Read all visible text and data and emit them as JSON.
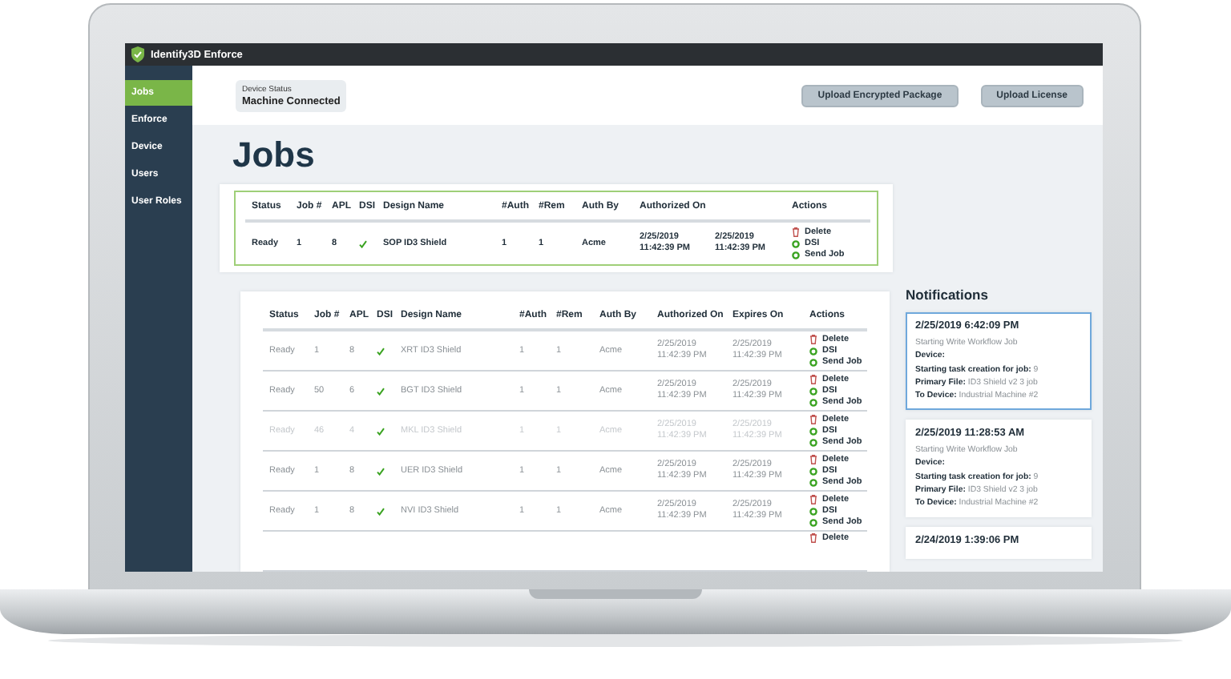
{
  "app": {
    "title": "Identify3D Enforce"
  },
  "sidebar": {
    "items": [
      {
        "label": "Jobs",
        "selected": true
      },
      {
        "label": "Enforce",
        "selected": false
      },
      {
        "label": "Device",
        "selected": false
      },
      {
        "label": "Users",
        "selected": false
      },
      {
        "label": "User Roles",
        "selected": false
      }
    ]
  },
  "header": {
    "device_status": {
      "label": "Device Status",
      "value": "Machine Connected"
    },
    "buttons": [
      "Upload Encrypted Package",
      "Upload License"
    ]
  },
  "page_title": "Jobs",
  "active_jobs": {
    "columns": [
      {
        "label": "Status"
      },
      {
        "label": "Job #"
      },
      {
        "label": "APL"
      },
      {
        "label": "DSI"
      },
      {
        "label": "Design Name"
      },
      {
        "label": "#Auth"
      },
      {
        "label": "#Rem"
      },
      {
        "label": "Auth By"
      },
      {
        "label": "Authorized On"
      },
      {},
      {
        "label": "Actions"
      }
    ],
    "rows": [
      {
        "faded": false,
        "cells": [
          "Ready",
          "1",
          "8"
        ],
        "dsi": true,
        "design": "SOP ID3 Shield",
        "cells2": [
          "1",
          "1",
          "Acme",
          "2/25/2019\n11:42:39 PM",
          "2/25/2019\n11:42:39 PM"
        ],
        "actions": [
          {
            "kind": "delete",
            "label": "Delete"
          },
          {
            "kind": "go",
            "label": "DSI"
          },
          {
            "kind": "go",
            "label": "Send Job"
          }
        ]
      }
    ]
  },
  "jobs": {
    "columns": [
      {
        "label": "Status"
      },
      {
        "label": "Job #"
      },
      {
        "label": "APL"
      },
      {
        "label": "DSI"
      },
      {
        "label": "Design Name"
      },
      {
        "label": "#Auth"
      },
      {
        "label": "#Rem"
      },
      {
        "label": "Auth By"
      },
      {
        "label": "Authorized On"
      },
      {
        "label": "Expires On"
      },
      {
        "label": "Actions"
      }
    ],
    "rows": [
      {
        "faded": false,
        "cells": [
          "Ready",
          "1",
          "8"
        ],
        "dsi": true,
        "design": "XRT ID3 Shield",
        "cells2": [
          "1",
          "1",
          "Acme",
          "2/25/2019\n11:42:39 PM",
          "2/25/2019\n11:42:39 PM"
        ],
        "actions": [
          {
            "kind": "delete",
            "label": "Delete"
          },
          {
            "kind": "go",
            "label": "DSI"
          },
          {
            "kind": "go",
            "label": "Send Job"
          }
        ]
      },
      {
        "faded": false,
        "cells": [
          "Ready",
          "50",
          "6"
        ],
        "dsi": true,
        "design": "BGT ID3 Shield",
        "cells2": [
          "1",
          "1",
          "Acme",
          "2/25/2019\n11:42:39 PM",
          "2/25/2019\n11:42:39 PM"
        ],
        "actions": [
          {
            "kind": "delete",
            "label": "Delete"
          },
          {
            "kind": "go",
            "label": "DSI"
          },
          {
            "kind": "go",
            "label": "Send Job"
          }
        ]
      },
      {
        "faded": true,
        "cells": [
          "Ready",
          "46",
          "4"
        ],
        "dsi": true,
        "design": "MKL ID3 Shield",
        "cells2": [
          "1",
          "1",
          "Acme",
          "2/25/2019\n11:42:39 PM",
          "2/25/2019\n11:42:39 PM"
        ],
        "actions": [
          {
            "kind": "delete",
            "label": "Delete"
          },
          {
            "kind": "go",
            "label": "DSI"
          },
          {
            "kind": "go",
            "label": "Send Job"
          }
        ]
      },
      {
        "faded": false,
        "cells": [
          "Ready",
          "1",
          "8"
        ],
        "dsi": true,
        "design": "UER ID3 Shield",
        "cells2": [
          "1",
          "1",
          "Acme",
          "2/25/2019\n11:42:39 PM",
          "2/25/2019\n11:42:39 PM"
        ],
        "actions": [
          {
            "kind": "delete",
            "label": "Delete"
          },
          {
            "kind": "go",
            "label": "DSI"
          },
          {
            "kind": "go",
            "label": "Send Job"
          }
        ]
      },
      {
        "faded": false,
        "cells": [
          "Ready",
          "1",
          "8"
        ],
        "dsi": true,
        "design": "NVI ID3 Shield",
        "cells2": [
          "1",
          "1",
          "Acme",
          "2/25/2019\n11:42:39 PM",
          "2/25/2019\n11:42:39 PM"
        ],
        "actions": [
          {
            "kind": "delete",
            "label": "Delete"
          },
          {
            "kind": "go",
            "label": "DSI"
          },
          {
            "kind": "go",
            "label": "Send Job"
          }
        ]
      },
      {
        "actions": [
          {
            "kind": "delete",
            "label": "Delete"
          }
        ]
      }
    ]
  },
  "notifications": {
    "title": "Notifications",
    "items": [
      {
        "selected": true,
        "time": "2/25/2019 6:42:09 PM",
        "message": "Starting Write Workflow Job",
        "fields": [
          {
            "label": "Device:"
          },
          {
            "label": "Starting task creation for job:",
            "value": "9"
          },
          {
            "label": "Primary File:",
            "value": "ID3 Shield v2 3 job"
          },
          {
            "label": "To Device:",
            "value": "Industrial Machine #2"
          }
        ]
      },
      {
        "selected": false,
        "time": "2/25/2019 11:28:53 AM",
        "message": "Starting Write Workflow Job",
        "fields": [
          {
            "label": "Device:"
          },
          {
            "label": "Starting task creation for job:",
            "value": "9"
          },
          {
            "label": "Primary File:",
            "value": "ID3 Shield v2 3 job"
          },
          {
            "label": "To Device:",
            "value": "Industrial Machine #2"
          }
        ]
      },
      {
        "selected": false,
        "time": "2/24/2019 1:39:06 PM"
      }
    ]
  }
}
